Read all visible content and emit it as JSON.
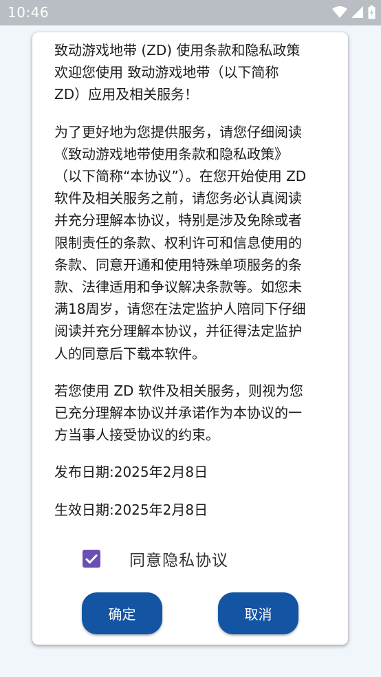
{
  "status_bar": {
    "time": "10:46",
    "icons": [
      "wifi-icon",
      "signal-icon",
      "battery-icon"
    ]
  },
  "dialog": {
    "paragraphs": [
      "致动游戏地带 (ZD) 使用条款和隐私政策\n欢迎您使用 致动游戏地带（以下简称\nZD）应用及相关服务！",
      "为了更好地为您提供服务，请您仔细阅读\n《致动游戏地带使用条款和隐私政策》\n（以下简称“本协议”）。在您开始使用 ZD\n软件及相关服务之前，请您务必认真阅读\n并充分理解本协议，特别是涉及免除或者\n限制责任的条款、权利许可和信息使用的\n条款、同意开通和使用特殊单项服务的条\n款、法律适用和争议解决条款等。如您未\n满18周岁，请您在法定监护人陪同下仔细\n阅读并充分理解本协议，并征得法定监护\n人的同意后下载本软件。",
      "若您使用 ZD 软件及相关服务，则视为您\n已充分理解本协议并承诺作为本协议的一\n方当事人接受协议的约束。",
      "发布日期:2025年2月8日",
      "生效日期:2025年2月8日"
    ],
    "agree_label": "同意隐私协议",
    "agree_checked": true,
    "confirm_label": "确定",
    "cancel_label": "取消"
  },
  "colors": {
    "accent": "#1455a3",
    "checkbox": "#6a4fb6",
    "status_bar": "#b9bdc4",
    "background": "#f1f6fb"
  }
}
